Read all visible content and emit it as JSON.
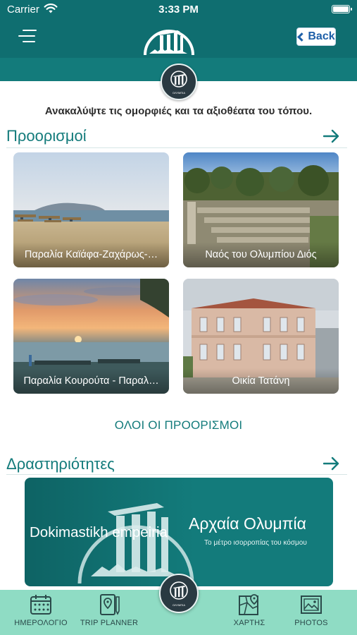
{
  "status_bar": {
    "carrier": "Carrier",
    "time": "3:33 PM"
  },
  "header": {
    "back_label": "Back"
  },
  "badge_caption": "ΟΛΥΜΠΙΑ",
  "tagline": "Ανακαλύψτε τις ομορφιές και τα αξιοθέατα του τόπου.",
  "destinations": {
    "title": "Προορισμοί",
    "cards": [
      {
        "label": "Παραλία Καϊάφα-Ζαχάρως-…"
      },
      {
        "label": "Ναός του Ολυμπίου Διός"
      },
      {
        "label": "Παραλία Κουρούτα - Παραλ…"
      },
      {
        "label": "Οικία Τατάνη"
      }
    ],
    "all_link": "ΟΛΟΙ ΟΙ ΠΡΟΟΡΙΣΜΟΙ"
  },
  "activities": {
    "title": "Δραστηριότητες",
    "banner": {
      "name": "Dokimastikh empeiria",
      "title": "Αρχαία Ολυμπία",
      "subtitle": "Το μέτρο ισορροπίας του κόσμου"
    }
  },
  "tabbar": {
    "items": [
      {
        "label": "ΗΜΕΡΟΛΟΓΙΟ",
        "icon": "calendar-icon"
      },
      {
        "label": "TRIP PLANNER",
        "icon": "trip-planner-icon"
      },
      {
        "label": "ΧΑΡΤΗΣ",
        "icon": "map-icon"
      },
      {
        "label": "PHOTOS",
        "icon": "photos-icon"
      }
    ]
  },
  "colors": {
    "primary": "#0f6e70",
    "accent": "#137b7b",
    "tabbar_bg": "#8fdcc4",
    "back_text": "#1e5fa8"
  }
}
